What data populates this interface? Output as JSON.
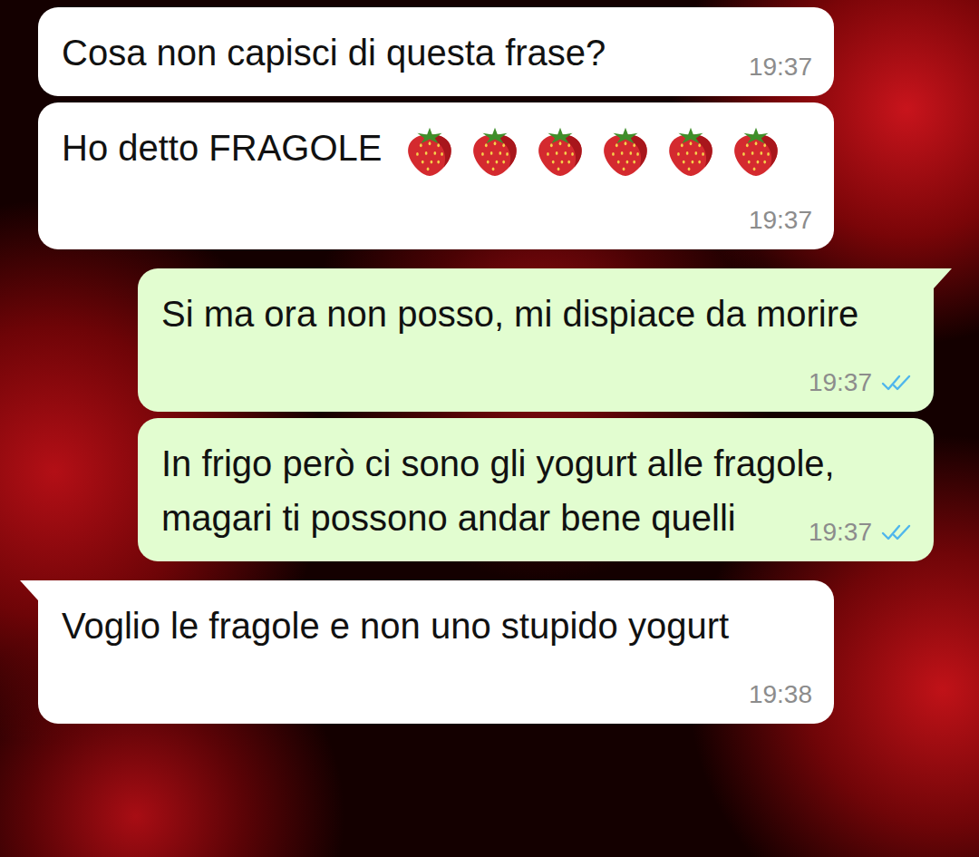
{
  "messages": [
    {
      "direction": "incoming",
      "text": "Cosa non capisci di questa frase?",
      "emojis": 0,
      "time": "19:37",
      "tail": false,
      "read": false
    },
    {
      "direction": "incoming",
      "text": "Ho detto FRAGOLE",
      "emojis": 6,
      "time": "19:37",
      "tail": false,
      "read": false
    },
    {
      "direction": "outgoing",
      "text": "Si ma ora non posso, mi dispiace da morire",
      "emojis": 0,
      "time": "19:37",
      "tail": true,
      "read": true
    },
    {
      "direction": "outgoing",
      "text": "In frigo però ci sono gli yogurt alle fragole, magari ti possono andar bene quelli",
      "emojis": 0,
      "time": "19:37",
      "tail": false,
      "read": true
    },
    {
      "direction": "incoming",
      "text": "Voglio le fragole e non uno stupido yogurt",
      "emojis": 0,
      "time": "19:38",
      "tail": true,
      "read": false
    }
  ]
}
